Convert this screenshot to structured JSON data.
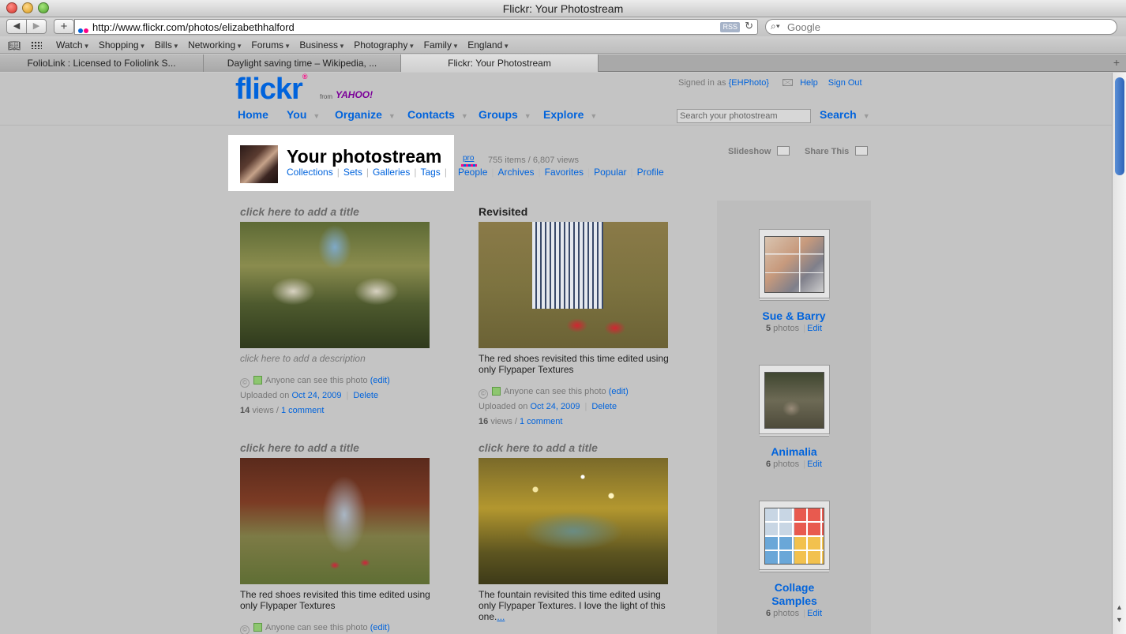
{
  "window": {
    "title": "Flickr: Your Photostream"
  },
  "browser": {
    "url": "http://www.flickr.com/photos/elizabethhalford",
    "rss_label": "RSS",
    "search_placeholder": "Google",
    "bookmarks": [
      {
        "label": "Watch"
      },
      {
        "label": "Shopping"
      },
      {
        "label": "Bills"
      },
      {
        "label": "Networking"
      },
      {
        "label": "Forums"
      },
      {
        "label": "Business"
      },
      {
        "label": "Photography"
      },
      {
        "label": "Family"
      },
      {
        "label": "England"
      }
    ],
    "tabs": [
      {
        "label": "FolioLink : Licensed to Foliolink S..."
      },
      {
        "label": "Daylight saving time – Wikipedia, ..."
      },
      {
        "label": "Flickr: Your Photostream",
        "active": true
      }
    ]
  },
  "flickr": {
    "logo": {
      "text": "flickr",
      "from": "from",
      "yahoo": "YAHOO!"
    },
    "userbar": {
      "signed_in_as": "Signed in as",
      "username": "{EHPhoto}",
      "help": "Help",
      "sign_out": "Sign Out"
    },
    "nav": [
      "Home",
      "You",
      "Organize",
      "Contacts",
      "Groups",
      "Explore"
    ],
    "search_placeholder": "Search your photostream",
    "search_button": "Search",
    "photostream": {
      "title": "Your photostream",
      "pro": "pro",
      "counts": "755 items / 6,807 views",
      "subnav": [
        "Collections",
        "Sets",
        "Galleries",
        "Tags",
        "People",
        "Archives",
        "Favorites",
        "Popular",
        "Profile"
      ],
      "slideshow": "Slideshow",
      "share": "Share This"
    },
    "photos": [
      {
        "title": "click here to add a title",
        "title_placeholder": true,
        "description": "click here to add a description",
        "desc_placeholder": true,
        "visibility": "Anyone can see this photo",
        "edit": "(edit)",
        "uploaded_label": "Uploaded on",
        "date": "Oct 24, 2009",
        "delete": "Delete",
        "views": "14",
        "views_label": "views",
        "comments": "1 comment"
      },
      {
        "title": "Revisited",
        "title_placeholder": false,
        "description": "The red shoes revisited this time edited using only Flypaper Textures",
        "desc_placeholder": false,
        "visibility": "Anyone can see this photo",
        "edit": "(edit)",
        "uploaded_label": "Uploaded on",
        "date": "Oct 24, 2009",
        "delete": "Delete",
        "views": "16",
        "views_label": "views",
        "comments": "1 comment"
      },
      {
        "title": "click here to add a title",
        "title_placeholder": true,
        "description": "The red shoes revisited this time edited using only Flypaper Textures",
        "desc_placeholder": false,
        "visibility": "Anyone can see this photo",
        "edit": "(edit)"
      },
      {
        "title": "click here to add a title",
        "title_placeholder": true,
        "description": "The fountain revisited this time edited using only Flypaper Textures. I love the light of this one.",
        "more": "...",
        "desc_placeholder": false
      }
    ],
    "sets": [
      {
        "title": "Sue & Barry",
        "count": "5",
        "count_label": "photos",
        "edit": "Edit"
      },
      {
        "title": "Animalia",
        "count": "6",
        "count_label": "photos",
        "edit": "Edit"
      },
      {
        "title": "Collage Samples",
        "count": "6",
        "count_label": "photos",
        "edit": "Edit"
      }
    ]
  }
}
